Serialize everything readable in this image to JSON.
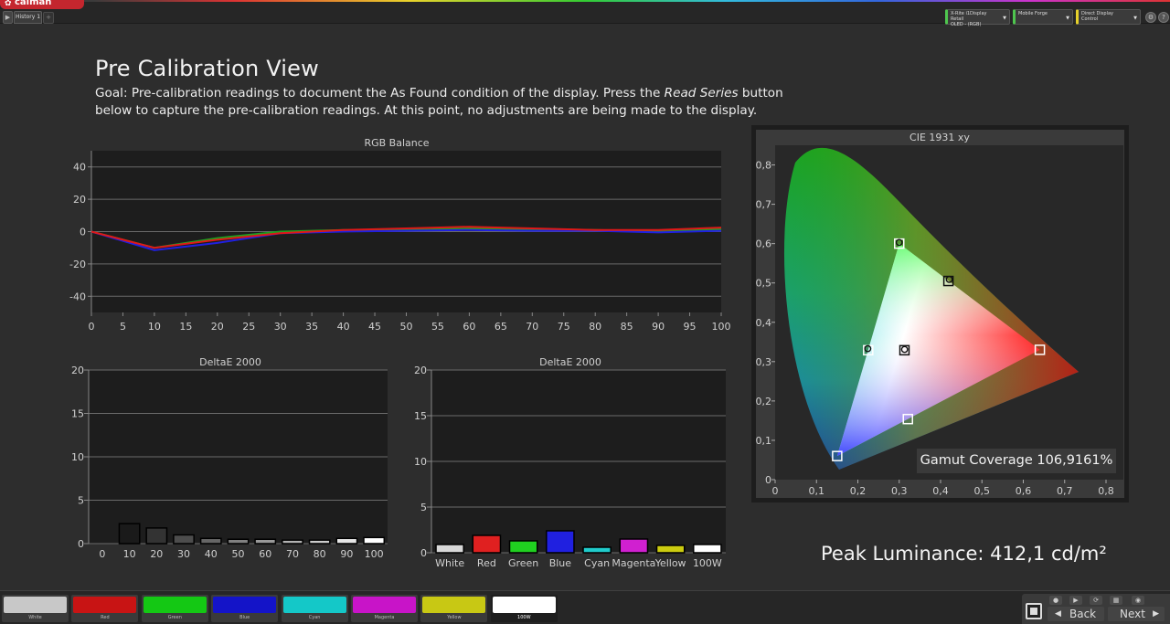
{
  "app": {
    "logo_text": "calman",
    "history_tab": "History 1",
    "devices": [
      {
        "line1": "X-Rite i1Display Retail",
        "line2": "OLED - (RGB)"
      },
      {
        "line1": "Mobile Forge",
        "line2": ""
      },
      {
        "line1": "Direct Display Control",
        "line2": ""
      }
    ]
  },
  "page": {
    "title": "Pre Calibration View",
    "goal_part1": "Goal: Pre-calibration readings to document the As Found condition of the display. Press the ",
    "goal_emph": "Read Series",
    "goal_part2": " button below to capture the pre-calibration readings. At this point, no adjustments are being made to the display."
  },
  "rgb_balance": {
    "type": "line",
    "title": "RGB Balance",
    "x": [
      0,
      10,
      20,
      30,
      40,
      50,
      60,
      70,
      80,
      90,
      100
    ],
    "xticks": [
      0,
      5,
      10,
      15,
      20,
      25,
      30,
      35,
      40,
      45,
      50,
      55,
      60,
      65,
      70,
      75,
      80,
      85,
      90,
      95,
      100
    ],
    "yticks": [
      40,
      20,
      0,
      -20,
      -40
    ],
    "xlim": [
      0,
      100
    ],
    "ylim": [
      -50,
      50
    ],
    "series": [
      {
        "color": "#1fa01f",
        "values": [
          0,
          -10,
          -4,
          0,
          1,
          1,
          2,
          1.5,
          1,
          0,
          1.5
        ]
      },
      {
        "color": "#2020e0",
        "values": [
          0,
          -11.5,
          -7,
          -1,
          0,
          0.5,
          1,
          0.5,
          0.5,
          -0.5,
          0.5
        ]
      },
      {
        "color": "#e01818",
        "values": [
          0,
          -10,
          -5,
          -1,
          1,
          2,
          3,
          2,
          1,
          1,
          2.5
        ]
      }
    ]
  },
  "delta_grayscale": {
    "type": "bar",
    "title": "DeltaE 2000",
    "categories": [
      "0",
      "10",
      "20",
      "30",
      "40",
      "50",
      "60",
      "70",
      "80",
      "90",
      "100"
    ],
    "values": [
      0,
      2.3,
      1.8,
      1.0,
      0.6,
      0.5,
      0.5,
      0.4,
      0.4,
      0.6,
      0.7
    ],
    "colors": [
      "#000000",
      "#1a1a1a",
      "#333333",
      "#4d4d4d",
      "#666666",
      "#808080",
      "#999999",
      "#b3b3b3",
      "#cccccc",
      "#e6e6e6",
      "#ffffff"
    ],
    "yticks": [
      20,
      15,
      10,
      5,
      0
    ],
    "ylim": [
      0,
      20
    ]
  },
  "delta_colors": {
    "type": "bar",
    "title": "DeltaE 2000",
    "categories": [
      "White",
      "Red",
      "Green",
      "Blue",
      "Cyan",
      "Magenta",
      "Yellow",
      "100W"
    ],
    "values": [
      0.9,
      1.9,
      1.3,
      2.4,
      0.6,
      1.5,
      0.8,
      0.9
    ],
    "colors": [
      "#d8d8d8",
      "#e02020",
      "#20d020",
      "#2020e0",
      "#20cccc",
      "#d020d0",
      "#cccc10",
      "#ffffff"
    ],
    "yticks": [
      20,
      15,
      10,
      5,
      0
    ],
    "ylim": [
      0,
      20
    ]
  },
  "cie": {
    "type": "scatter",
    "title": "CIE 1931 xy",
    "xticks": [
      "0",
      "0,1",
      "0,2",
      "0,3",
      "0,4",
      "0,5",
      "0,6",
      "0,7",
      "0,8"
    ],
    "yticks": [
      "0,8",
      "0,7",
      "0,6",
      "0,5",
      "0,4",
      "0,3",
      "0,2",
      "0,1",
      "0"
    ],
    "xlim": [
      0,
      0.8
    ],
    "ylim": [
      0,
      0.85
    ],
    "targets": [
      {
        "name": "Red",
        "x": 0.64,
        "y": 0.33
      },
      {
        "name": "Green",
        "x": 0.3,
        "y": 0.6
      },
      {
        "name": "Blue",
        "x": 0.15,
        "y": 0.06
      },
      {
        "name": "Cyan",
        "x": 0.225,
        "y": 0.329
      },
      {
        "name": "Magenta",
        "x": 0.321,
        "y": 0.154
      },
      {
        "name": "Yellow",
        "x": 0.419,
        "y": 0.505
      },
      {
        "name": "White",
        "x": 0.3127,
        "y": 0.329
      }
    ],
    "measured": [
      {
        "name": "Green",
        "x": 0.3,
        "y": 0.603
      },
      {
        "name": "Cyan",
        "x": 0.224,
        "y": 0.333
      },
      {
        "name": "Yellow",
        "x": 0.421,
        "y": 0.509
      },
      {
        "name": "White",
        "x": 0.313,
        "y": 0.331
      }
    ],
    "gamut_coverage": "Gamut Coverage 106,9161%"
  },
  "peak_luminance": "Peak Luminance: 412,1 cd/m²",
  "patches": [
    {
      "label": "White",
      "color": "#c8c8c8"
    },
    {
      "label": "Red",
      "color": "#c81414"
    },
    {
      "label": "Green",
      "color": "#14c814"
    },
    {
      "label": "Blue",
      "color": "#1414c8"
    },
    {
      "label": "Cyan",
      "color": "#14c8c8"
    },
    {
      "label": "Magenta",
      "color": "#c814c8"
    },
    {
      "label": "Yellow",
      "color": "#c8c814"
    },
    {
      "label": "100W",
      "color": "#ffffff"
    }
  ],
  "nav": {
    "back": "Back",
    "next": "Next"
  }
}
